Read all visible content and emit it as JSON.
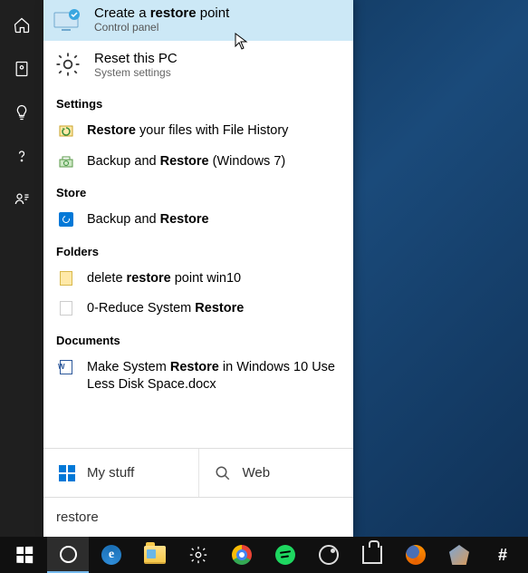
{
  "rail": [
    "home",
    "recent",
    "insight",
    "help",
    "feedback"
  ],
  "best": {
    "title_pre": "Create a ",
    "title_hl": "restore",
    "title_post": " point",
    "subtitle": "Control panel"
  },
  "second": {
    "title": "Reset this PC",
    "subtitle": "System settings"
  },
  "categories": {
    "settings": {
      "header": "Settings",
      "items": [
        {
          "pre": "",
          "hl": "Restore",
          "post": " your files with File History"
        },
        {
          "pre": "Backup and ",
          "hl": "Restore",
          "post": " (Windows 7)"
        }
      ]
    },
    "store": {
      "header": "Store",
      "items": [
        {
          "pre": "Backup and ",
          "hl": "Restore",
          "post": ""
        }
      ]
    },
    "folders": {
      "header": "Folders",
      "items": [
        {
          "pre": "delete ",
          "hl": "restore",
          "post": " point win10"
        },
        {
          "pre": "0-Reduce System ",
          "hl": "Restore",
          "post": ""
        }
      ]
    },
    "documents": {
      "header": "Documents",
      "items": [
        {
          "pre": "Make System ",
          "hl": "Restore",
          "post": " in Windows 10 Use Less Disk Space.docx"
        }
      ]
    }
  },
  "scope": {
    "mystuff": "My stuff",
    "web": "Web"
  },
  "search_query": "restore",
  "taskbar": [
    "start",
    "cortana",
    "edge",
    "explorer",
    "settings",
    "chrome",
    "spotify",
    "groove",
    "store",
    "firefox",
    "app",
    "slack"
  ]
}
